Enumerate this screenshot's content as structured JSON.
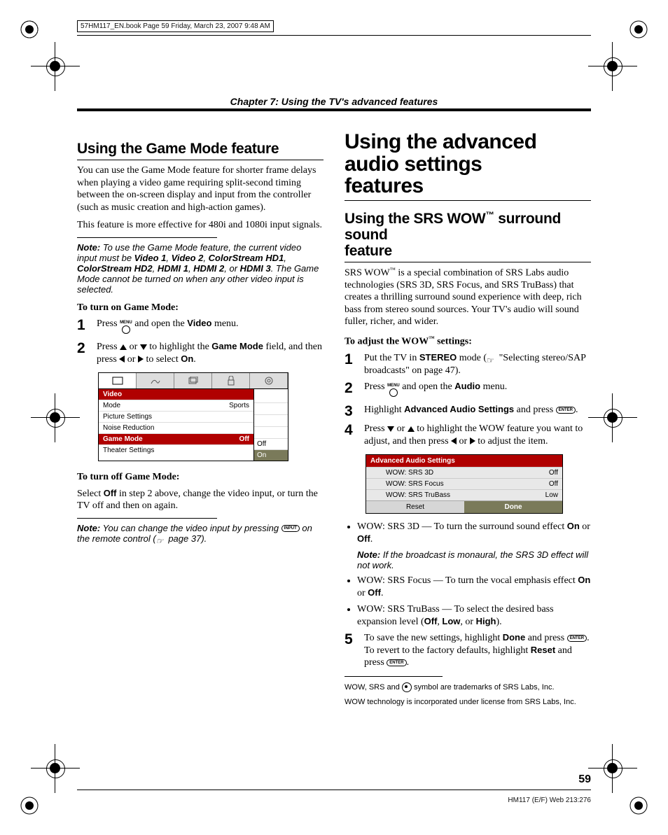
{
  "meta": {
    "framemaker_line": "57HM117_EN.book  Page 59  Friday, March 23, 2007  9:48 AM",
    "chapter": "Chapter 7: Using the TV's advanced features",
    "page_number": "59",
    "footer": "HM117 (E/F) Web 213:276"
  },
  "left": {
    "h2": "Using the Game Mode feature",
    "p1": "You can use the Game Mode feature for shorter frame delays when playing a video game requiring split-second timing between the on-screen display and input from the controller (such as music creation and high-action games).",
    "p2": "This feature is more effective for 480i and 1080i input signals.",
    "note1_label": "Note:",
    "note1_a": " To use the Game Mode feature, the current video input must be ",
    "note1_inputs": [
      "Video 1",
      "Video 2",
      "ColorStream HD1",
      "ColorStream HD2",
      "HDMI 1",
      "HDMI 2",
      "HDMI 3"
    ],
    "note1_b": ". The Game Mode cannot be turned on when any other video input is selected.",
    "h3a": "To turn on Game Mode:",
    "s1_a": "Press ",
    "s1_b": " and open the ",
    "s1_menu": "Video",
    "s1_c": " menu.",
    "s2_a": "Press ",
    "s2_b": " or ",
    "s2_c": " to highlight the ",
    "s2_field": "Game Mode",
    "s2_d": " field, and then press ",
    "s2_e": " or ",
    "s2_f": " to select ",
    "s2_on": "On",
    "s2_g": ".",
    "osd": {
      "title": "Video",
      "rows": [
        {
          "l": "Mode",
          "r": "Sports"
        },
        {
          "l": "Picture Settings",
          "r": ""
        },
        {
          "l": "Noise Reduction",
          "r": ""
        },
        {
          "l": "Game Mode",
          "r": "Off"
        },
        {
          "l": "Theater Settings",
          "r": ""
        }
      ],
      "popup": [
        "Off",
        "On"
      ]
    },
    "h3b": "To turn off Game Mode:",
    "off_a": "Select ",
    "off_b": "Off",
    "off_c": " in step 2 above, change the video input, or turn the TV off and then on again.",
    "note2_label": "Note:",
    "note2_a": " You can change the video input by pressing ",
    "note2_btn": "INPUT",
    "note2_b": " on the remote control (",
    "note2_c": " page 37)."
  },
  "right": {
    "h1a": "Using the advanced audio settings",
    "h1b": "features",
    "h2a": "Using the SRS WOW",
    "h2b": " surround sound",
    "h2c": "feature",
    "p1a": "SRS WOW",
    "p1b": " is a special combination of SRS Labs audio technologies (SRS 3D, SRS Focus, and SRS TruBass) that creates a thrilling surround sound experience with deep, rich bass from stereo sound sources. Your TV's audio will sound fuller, richer, and wider.",
    "h3": "To adjust the WOW",
    "h3b": " settings:",
    "s1_a": "Put the TV in ",
    "s1_mode": "STEREO",
    "s1_b": " mode (",
    "s1_c": " \"Selecting stereo/SAP broadcasts\" on page 47).",
    "s2_a": "Press ",
    "s2_b": " and open the ",
    "s2_menu": "Audio",
    "s2_c": " menu.",
    "s3_a": "Highlight ",
    "s3_item": "Advanced Audio Settings",
    "s3_b": " and press ",
    "s3_btn": "ENTER",
    "s3_c": ".",
    "s4_a": "Press ",
    "s4_b": " or ",
    "s4_c": " to highlight the WOW feature you want to adjust, and then press ",
    "s4_d": " or ",
    "s4_e": " to adjust the item.",
    "osd": {
      "title": "Advanced Audio Settings",
      "rows": [
        {
          "l": "WOW: SRS 3D",
          "r": "Off"
        },
        {
          "l": "WOW: SRS Focus",
          "r": "Off"
        },
        {
          "l": "WOW: SRS TruBass",
          "r": "Low"
        }
      ],
      "btns": [
        "Reset",
        "Done"
      ]
    },
    "b1_a": "WOW: SRS 3D — To turn the surround sound effect ",
    "b1_on": "On",
    "b1_or": " or ",
    "b1_off": "Off",
    "b1_b": ".",
    "b1_note_label": "Note:",
    "b1_note": " If the broadcast is monaural, the SRS 3D effect will not work.",
    "b2_a": "WOW: SRS Focus — To turn the vocal emphasis effect ",
    "b2_on": "On",
    "b2_or": " or ",
    "b2_off": "Off",
    "b2_b": ".",
    "b3_a": "WOW: SRS TruBass — To select the desired bass expansion level (",
    "b3_off": "Off",
    "b3_c1": ", ",
    "b3_low": "Low",
    "b3_c2": ", or ",
    "b3_high": "High",
    "b3_b": ").",
    "s5_a": "To save the new settings, highlight ",
    "s5_done": "Done",
    "s5_b": " and press ",
    "s5_btn1": "ENTER",
    "s5_c": ". To revert to the factory defaults, highlight ",
    "s5_reset": "Reset",
    "s5_d": " and press ",
    "s5_btn2": "ENTER",
    "s5_e": ".",
    "fn1": "WOW, SRS and ",
    "fn1b": " symbol are trademarks of SRS Labs, Inc.",
    "fn2": "WOW technology is incorporated under license from SRS Labs, Inc."
  }
}
